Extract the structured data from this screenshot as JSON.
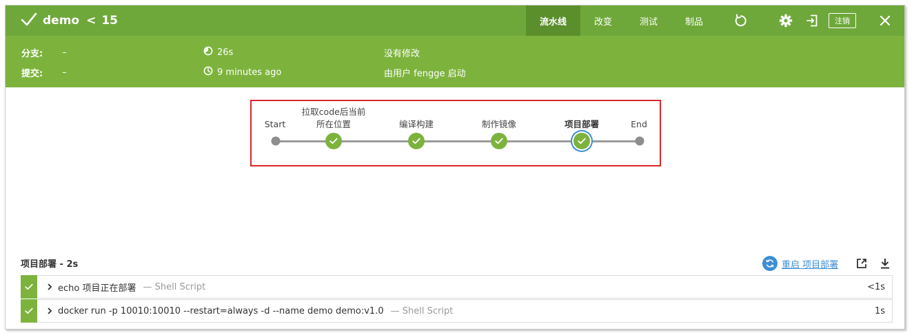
{
  "header": {
    "run_name": "demo",
    "separator": "<",
    "run_number": "15",
    "tabs": [
      {
        "label": "流水线",
        "active": true
      },
      {
        "label": "改变",
        "active": false
      },
      {
        "label": "测试",
        "active": false
      },
      {
        "label": "制品",
        "active": false
      }
    ],
    "logout_label": "注销",
    "icons": [
      "check-icon",
      "replay-icon",
      "gear-icon",
      "exit-icon",
      "close-icon"
    ]
  },
  "summary": {
    "branch_label": "分支:",
    "branch_value": "–",
    "commit_label": "提交:",
    "commit_value": "–",
    "duration": "26s",
    "time_ago": "9 minutes ago",
    "changes": "没有修改",
    "started_by": "由用户 fengge 启动"
  },
  "pipeline": {
    "stages": [
      {
        "label": "Start",
        "kind": "plain"
      },
      {
        "label_line1": "拉取code后当前",
        "label_line2": "所在位置",
        "kind": "success"
      },
      {
        "label": "编译构建",
        "kind": "success"
      },
      {
        "label": "制作镜像",
        "kind": "success"
      },
      {
        "label": "项目部署",
        "kind": "success",
        "selected": true
      },
      {
        "label": "End",
        "kind": "plain"
      }
    ]
  },
  "steps": {
    "title": "项目部署 - 2s",
    "restart_label": "重启 项目部署",
    "items": [
      {
        "text": "echo 项目正在部署",
        "kind": "— Shell Script",
        "duration": "<1s",
        "status": "success"
      },
      {
        "text": "docker run -p 10010:10010 --restart=always -d --name demo demo:v1.0",
        "kind": "— Shell Script",
        "duration": "1s",
        "status": "success"
      }
    ]
  },
  "colors": {
    "header_green": "#6fa83a",
    "summary_green": "#7db33d",
    "success_green": "#7db33d",
    "link_blue": "#3b8ed4",
    "highlight_red": "#d9252b"
  }
}
